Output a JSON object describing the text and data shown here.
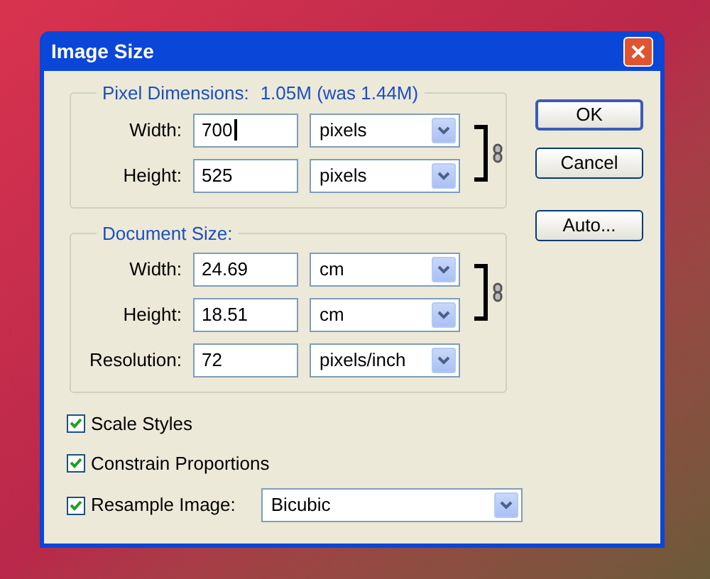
{
  "window": {
    "title": "Image Size"
  },
  "pixel_dimensions": {
    "legend": "Pixel Dimensions:",
    "summary": "1.05M (was 1.44M)",
    "fields": [
      {
        "label": "Width:",
        "value": "700",
        "focused": true,
        "unit": "pixels",
        "linked": true
      },
      {
        "label": "Height:",
        "value": "525",
        "focused": false,
        "unit": "pixels",
        "linked": true
      }
    ]
  },
  "document_size": {
    "legend": "Document Size:",
    "fields": [
      {
        "label": "Width:",
        "value": "24.69",
        "focused": false,
        "unit": "cm",
        "linked": true
      },
      {
        "label": "Height:",
        "value": "18.51",
        "focused": false,
        "unit": "cm",
        "linked": true
      },
      {
        "label": "Resolution:",
        "value": "72",
        "focused": false,
        "unit": "pixels/inch",
        "linked": false
      }
    ]
  },
  "options": [
    {
      "label": "Scale Styles",
      "checked": true
    },
    {
      "label": "Constrain Proportions",
      "checked": true
    },
    {
      "label": "Resample Image:",
      "checked": true,
      "select": "Bicubic"
    }
  ],
  "buttons": [
    {
      "label": "OK",
      "default": true
    },
    {
      "label": "Cancel",
      "default": false
    },
    {
      "label": "Auto...",
      "default": false
    }
  ]
}
